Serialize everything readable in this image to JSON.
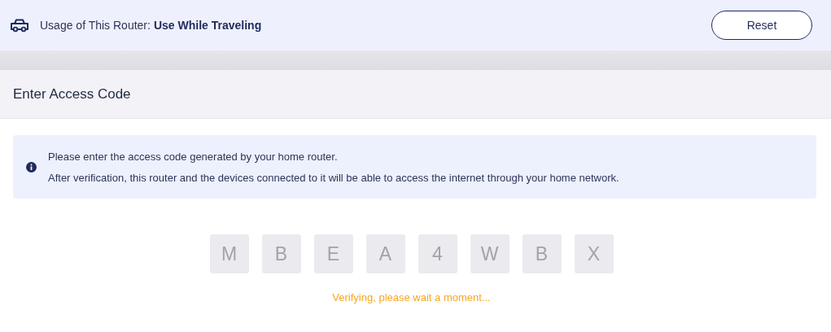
{
  "usage_bar": {
    "label": "Usage of This Router:",
    "value": "Use While Traveling",
    "reset_button": "Reset"
  },
  "panel": {
    "title": "Enter Access Code",
    "notice": [
      "Please enter the access code generated by your home router.",
      "After verification, this router and the devices connected to it will be able to access the internet through your home network."
    ],
    "code": [
      {
        "char": "M",
        "disabled": true
      },
      {
        "char": "B",
        "disabled": true
      },
      {
        "char": "E",
        "disabled": true
      },
      {
        "char": "A",
        "disabled": true
      },
      {
        "char": "4",
        "disabled": true
      },
      {
        "char": "W",
        "disabled": true
      },
      {
        "char": "B",
        "disabled": true
      },
      {
        "char": "X",
        "disabled": true
      }
    ],
    "status": "Verifying, please wait a moment..."
  }
}
